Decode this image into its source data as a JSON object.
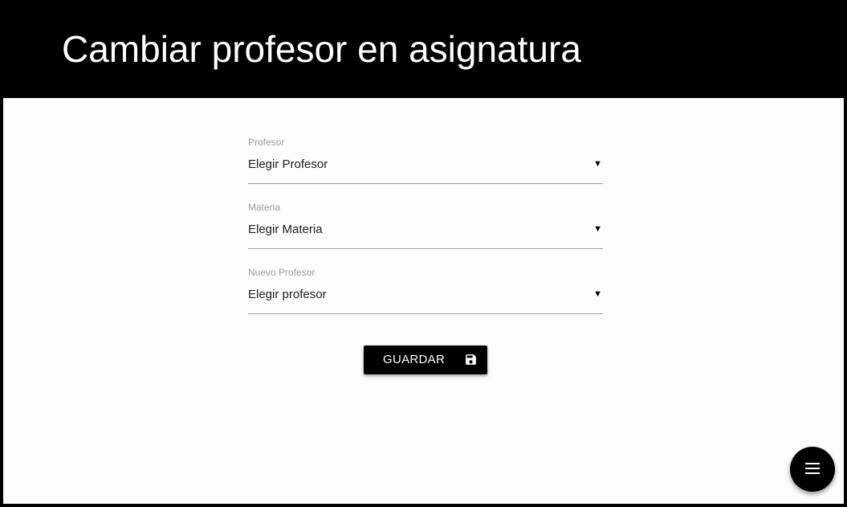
{
  "header": {
    "title": "Cambiar profesor en asignatura"
  },
  "form": {
    "fields": [
      {
        "label": "Profesor",
        "value": "Elegir Profesor"
      },
      {
        "label": "Materia",
        "value": "Elegir Materia"
      },
      {
        "label": "Nuevo Profesor",
        "value": "Elegir profesor"
      }
    ],
    "caret_glyph": "▼",
    "save_button": {
      "label": "GUARDAR",
      "icon": "save-icon"
    }
  },
  "fab": {
    "icon": "menu-icon"
  },
  "colors": {
    "header_bg": "#000000",
    "content_bg": "#fcfcfc",
    "label_text": "#9e9e9e",
    "value_text": "#212121",
    "underline": "#9e9e9e",
    "button_bg": "#000000",
    "button_text": "#ffffff"
  }
}
